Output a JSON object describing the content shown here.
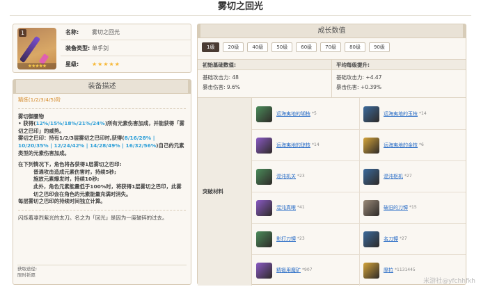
{
  "page_title": "雾切之回光",
  "info": {
    "badge": "1",
    "name_label": "名称:",
    "name_value": "雾切之回光",
    "type_label": "装备类型:",
    "type_value": "单手剑",
    "rarity_label": "星级:",
    "rarity_value": "★★★★★",
    "thumb_stars": "★★★★★"
  },
  "desc": {
    "header": "装备描述",
    "refine": "精炼(1/2/3/4/5)阶",
    "p1_title": "雾切御腰物",
    "p1_a": "• 获得(",
    "p1_a_hl": "12%/15%/18%/21%/24%",
    "p1_a2": ")所有元素伤害加成，并能获得「雾切之巴印」的威势。",
    "p1_b": "雾切之巴印：持有1/2/3层雾切之巴印时,获得(",
    "p1_b_hl": "8/16/28% | 10/20/35% | 12/24/42% | 14/28/49% | 16/32/56%",
    "p1_b2": ")自己的元素类型的元素伤害加成。",
    "p2": "在下列情况下，角色将各获得1层雾切之巴印:",
    "p3": "普通攻击造成元素伤害时，持续5秒;",
    "p4": "施放元素爆发时，持续10秒;",
    "p5": "此外，角色元素能量低于100%时，将获得1层雾切之巴印，此雾切之巴印会在角色的元素能量充满时消失。",
    "p6": "每层雾切之巴印的持续时间独立计算。",
    "flavor": "闪烁着凛烈紫光的太刀。名之为「回光」是因为一度破碎的过去。",
    "source_label": "获取途径:",
    "source_value": "限时祈愿"
  },
  "growth": {
    "header": "成长数值",
    "levels": [
      "1级",
      "20级",
      "40级",
      "50级",
      "60级",
      "70级",
      "80级",
      "90级"
    ],
    "active_level": "1级",
    "base_head": "初始基础数值:",
    "avg_head": "平均每级提升:",
    "base_atk": "基础攻击力: 48",
    "base_crit": "暴击伤害: 9.6%",
    "avg_atk": "基础攻击力: +4.47",
    "avg_crit": "暴击伤害: +0.39%",
    "mat_label": "突破材料",
    "materials": [
      {
        "name": "远海夷地的瑚枝",
        "count": "*5",
        "icon": "coral-branch-icon",
        "color": "#4b8c5a"
      },
      {
        "name": "远海夷地的玉枝",
        "count": "*14",
        "icon": "jade-branch-icon",
        "color": "#3b6a9c"
      },
      {
        "name": "远海夷地的琼枝",
        "count": "*14",
        "icon": "jasper-branch-icon",
        "color": "#8a5ac4"
      },
      {
        "name": "远海夷地的金枝",
        "count": "*6",
        "icon": "golden-branch-icon",
        "color": "#d4a43a"
      },
      {
        "name": "混沌机关",
        "count": "*23",
        "icon": "chaos-device-icon",
        "color": "#4b8c5a"
      },
      {
        "name": "混沌枢机",
        "count": "*27",
        "icon": "chaos-circuit-icon",
        "color": "#3b6a9c"
      },
      {
        "name": "混沌真眼",
        "count": "*41",
        "icon": "chaos-core-icon",
        "color": "#8a5ac4"
      },
      {
        "name": "破旧的刀镡",
        "count": "*15",
        "icon": "old-handguard-icon",
        "color": "#9a8a78"
      },
      {
        "name": "影打刀镡",
        "count": "*23",
        "icon": "kageuchi-handguard-icon",
        "color": "#4b8c5a"
      },
      {
        "name": "名刀镡",
        "count": "*27",
        "icon": "famed-handguard-icon",
        "color": "#3b6a9c"
      },
      {
        "name": "精锻用魔矿",
        "count": "*907",
        "icon": "mystic-ore-icon",
        "color": "#8a5ac4"
      },
      {
        "name": "摩拉",
        "count": "*1131445",
        "icon": "mora-icon",
        "color": "#d4a43a"
      }
    ]
  },
  "watermark": "米游社@yfchhfkh"
}
